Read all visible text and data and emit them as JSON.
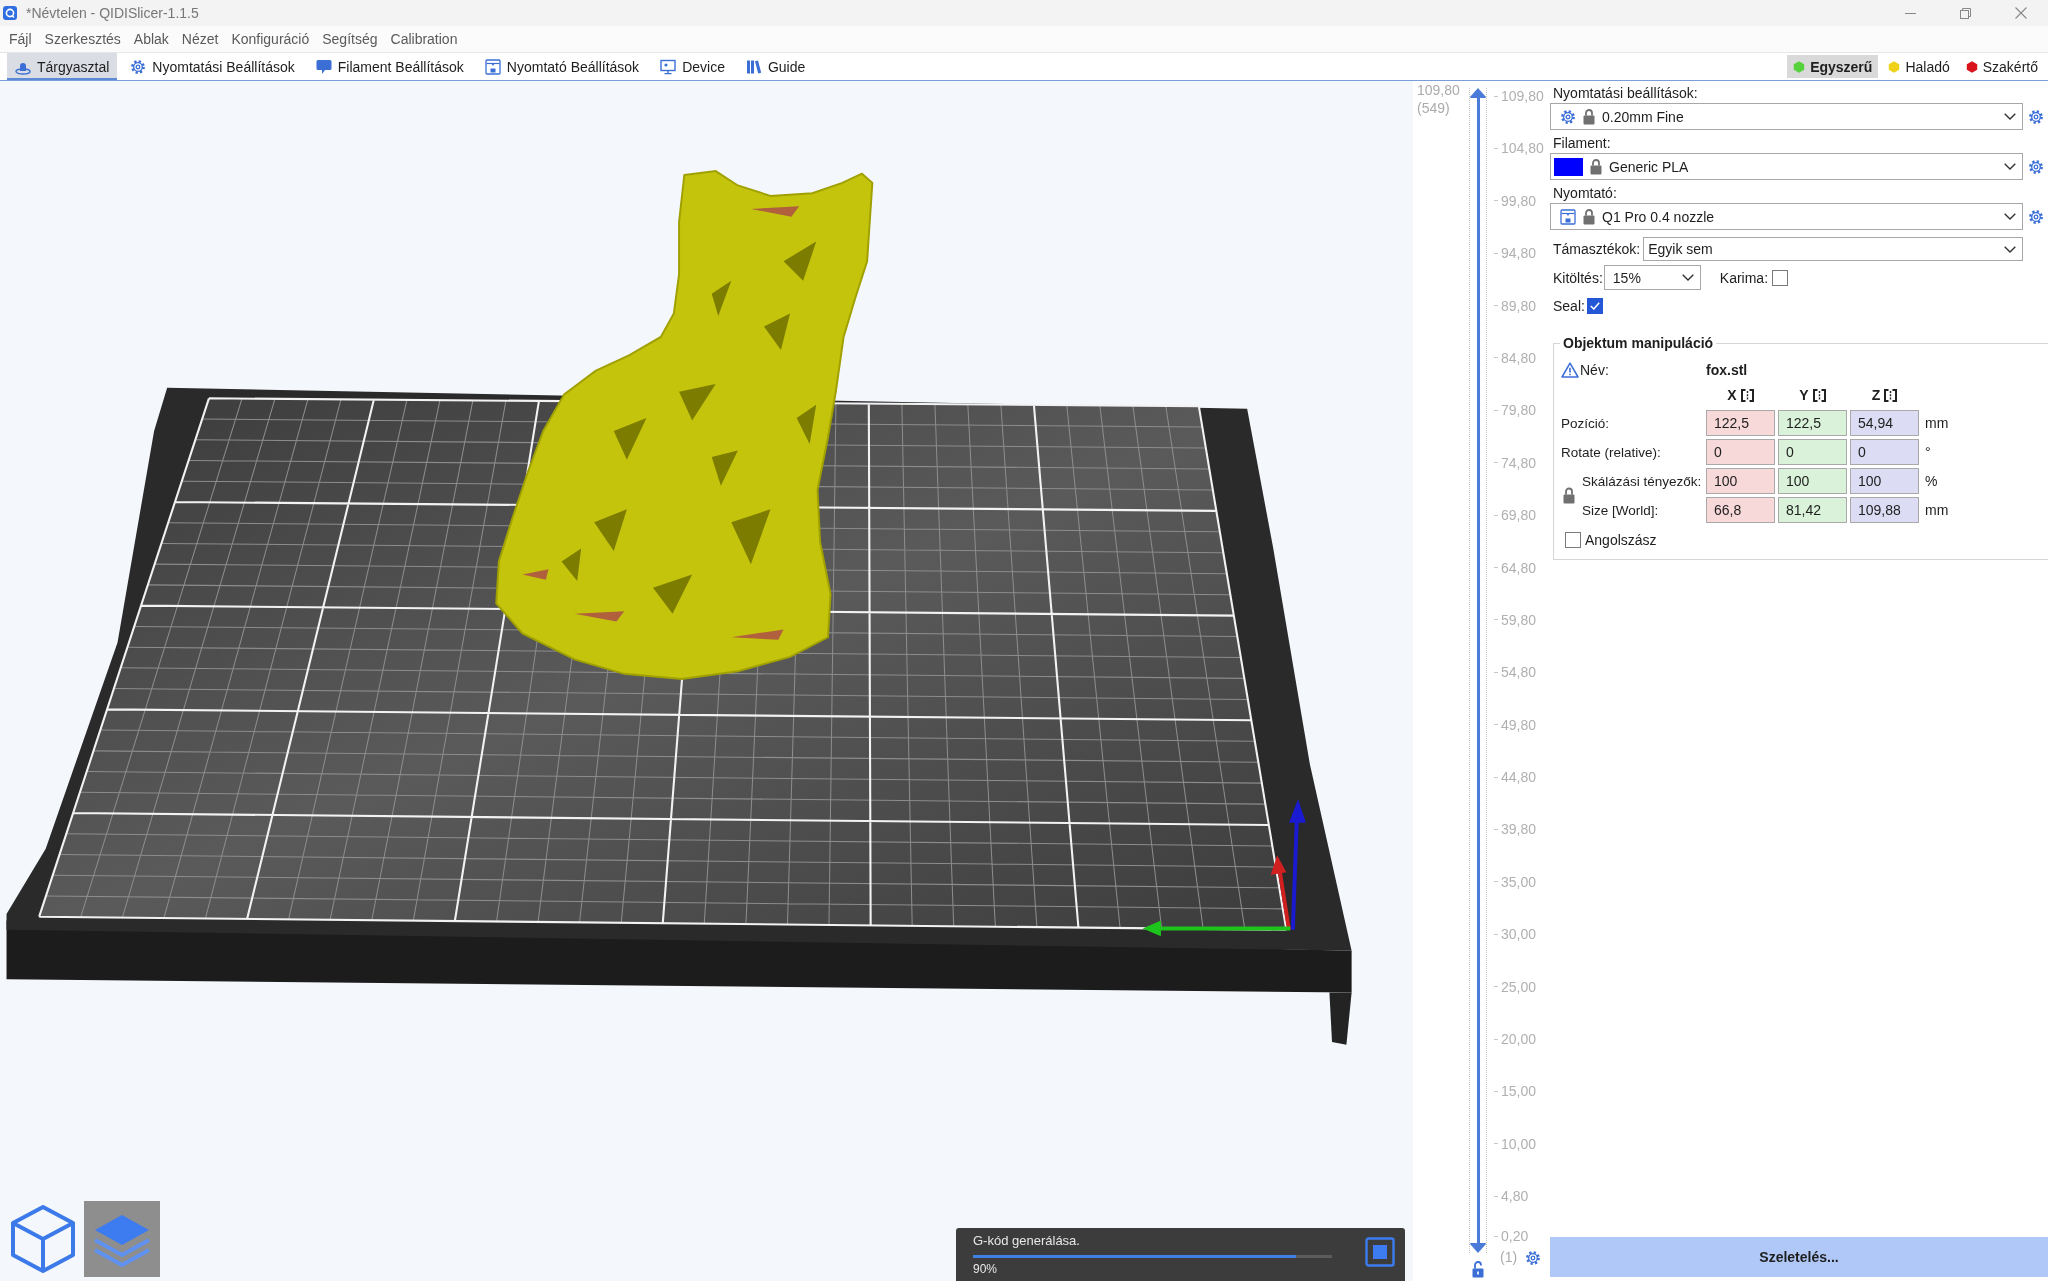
{
  "window": {
    "title": "*Névtelen - QIDISlicer-1.1.5"
  },
  "menu": [
    "Fájl",
    "Szerkesztés",
    "Ablak",
    "Nézet",
    "Konfiguráció",
    "Segítség",
    "Calibration"
  ],
  "tabs": [
    {
      "label": "Tárgyasztal",
      "kind": "plate",
      "selected": true
    },
    {
      "label": "Nyomtatási Beállítások",
      "kind": "print",
      "selected": false
    },
    {
      "label": "Filament Beállítások",
      "kind": "filament",
      "selected": false
    },
    {
      "label": "Nyomtató Beállítások",
      "kind": "printer",
      "selected": false
    },
    {
      "label": "Device",
      "kind": "device",
      "selected": false
    },
    {
      "label": "Guide",
      "kind": "guide",
      "selected": false
    }
  ],
  "modes": [
    {
      "label": "Egyszerű",
      "color": "#55d23c",
      "selected": true
    },
    {
      "label": "Haladó",
      "color": "#f0d21a",
      "selected": false
    },
    {
      "label": "Szakértő",
      "color": "#d8131b",
      "selected": false
    }
  ],
  "view_buttons": [
    {
      "kind": "perspective",
      "selected": false
    },
    {
      "kind": "preview",
      "selected": true
    }
  ],
  "progress": {
    "label": "G-kód generálása.",
    "level": 0.9,
    "reading": "90%"
  },
  "layer_slider": {
    "upper": {
      "value": "109,80",
      "layer": "(549)",
      "level": 1
    },
    "lower": {
      "layer": "(1)",
      "level": 0
    },
    "ticks": [
      "109,80",
      "104,80",
      "99,80",
      "94,80",
      "89,80",
      "84,80",
      "79,80",
      "74,80",
      "69,80",
      "64,80",
      "59,80",
      "54,80",
      "49,80",
      "44,80",
      "39,80",
      "35,00",
      "30,00",
      "25,00",
      "20,00",
      "15,00",
      "10,00",
      "4,80",
      "0,20"
    ]
  },
  "presets": [
    {
      "kind": "print",
      "label": "Nyomtatási beállítások:",
      "value": "0.20mm Fine"
    },
    {
      "kind": "filament",
      "label": "Filament:",
      "value": "Generic PLA",
      "color": "#0000ff"
    },
    {
      "kind": "printer",
      "label": "Nyomtató:",
      "value": "Q1 Pro 0.4 nozzle"
    }
  ],
  "supports": {
    "label": "Támasztékok:",
    "value": "Egyik sem"
  },
  "infill": {
    "label": "Kitöltés:",
    "value": "15%"
  },
  "brim": {
    "label": "Karima:",
    "checked": false
  },
  "seal": {
    "label": "Seal:",
    "checked": true
  },
  "object_manipulation": {
    "title": "Objektum manipuláció",
    "name_label": "Név:",
    "name": "fox.stl",
    "axes": [
      "X",
      "Y",
      "Z"
    ],
    "rows": [
      {
        "kind": "plain",
        "label": "Pozíció:",
        "values": [
          "122,5",
          "122,5",
          "54,94"
        ],
        "unit": "mm"
      },
      {
        "kind": "plain",
        "label": "Rotate (relative):",
        "values": [
          "0",
          "0",
          "0"
        ],
        "unit": "°"
      },
      {
        "kind": "linked",
        "label": "Skálázási tényezők:",
        "values": [
          "100",
          "100",
          "100"
        ],
        "unit": "%"
      },
      {
        "kind": "linked",
        "label": "Size [World]:",
        "values": [
          "66,8",
          "81,42",
          "109,88"
        ],
        "unit": "mm"
      }
    ],
    "english_units": {
      "label": "Angolszász",
      "checked": false
    }
  },
  "slice_button": {
    "label": "Szeletelés..."
  }
}
